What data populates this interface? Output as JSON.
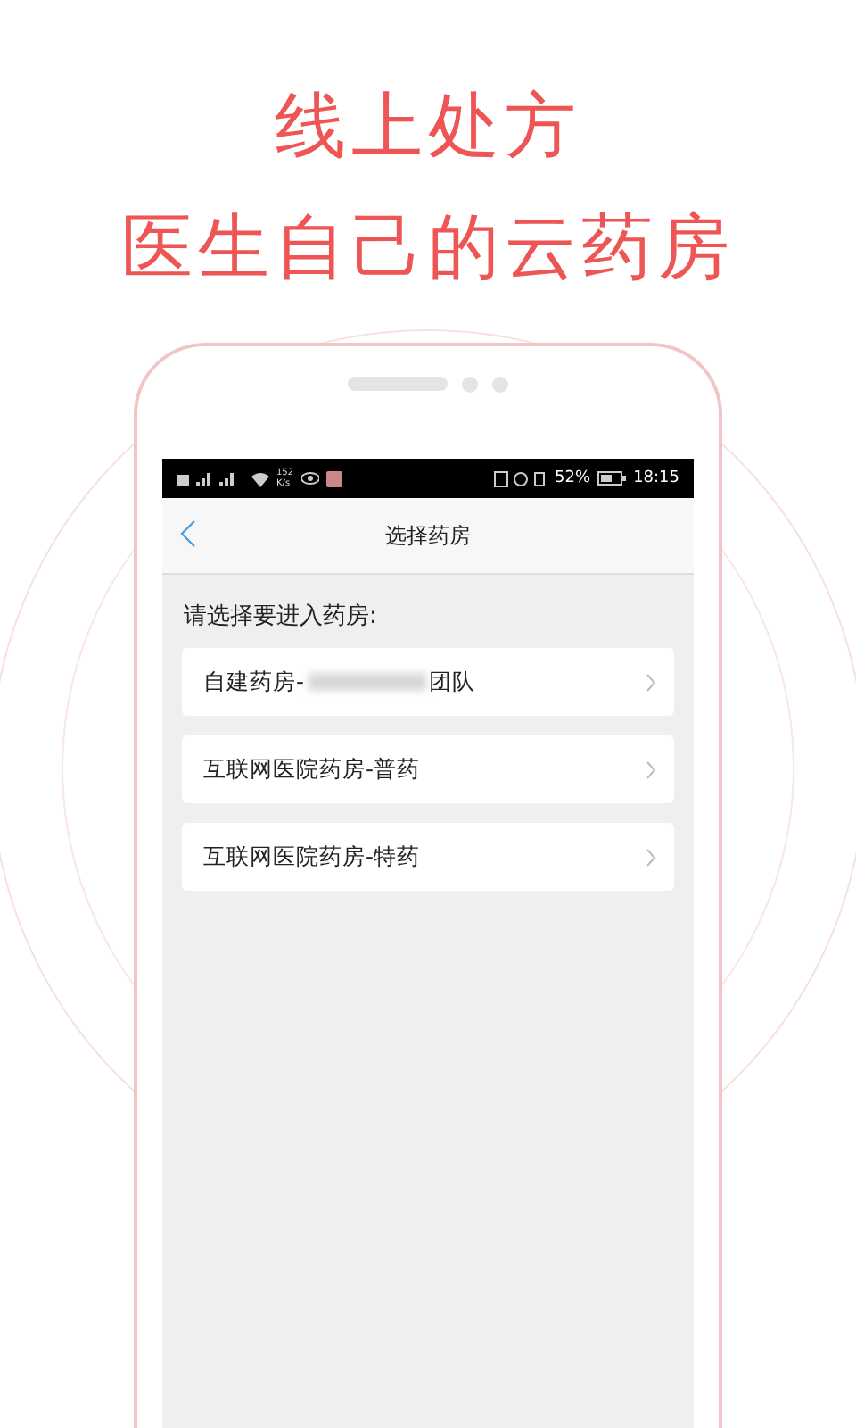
{
  "headline": [
    "线上处方",
    "医生自己的云药房"
  ],
  "status_bar": {
    "speed": "152",
    "speed_unit": "K/s",
    "battery": "52%",
    "time": "18:15"
  },
  "nav": {
    "title": "选择药房"
  },
  "prompt": "请选择要进入药房:",
  "pharmacies": [
    {
      "label": "自建药房-",
      "redacted": true,
      "label_after": "团队"
    },
    {
      "label": "互联网医院药房-普药",
      "redacted": false
    },
    {
      "label": "互联网医院药房-特药",
      "redacted": false
    }
  ]
}
